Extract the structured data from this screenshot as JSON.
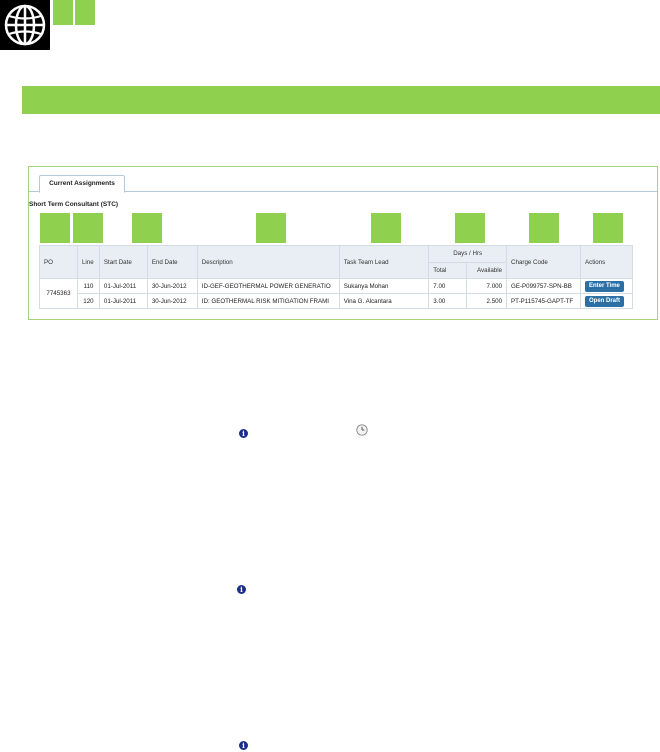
{
  "header": {
    "logo_icon": "world-bank-globe-icon",
    "accent_color": "#8fd14f"
  },
  "panel": {
    "tab_label": "Current Assignments",
    "section_title": "Short Term Consultant (STC)"
  },
  "table": {
    "columns": {
      "po": "PO",
      "line": "Line",
      "start_date": "Start Date",
      "end_date": "End Date",
      "description": "Description",
      "task_team_lead": "Task Team Lead",
      "days_hrs": "Days / Hrs",
      "total": "Total",
      "available": "Available",
      "charge_code": "Charge Code",
      "actions": "Actions"
    },
    "po_value": "7745363",
    "rows": [
      {
        "line": "110",
        "start_date": "01-Jul-2011",
        "end_date": "30-Jun-2012",
        "description": "ID-GEF-GEOTHERMAL POWER GENERATIO",
        "task_team_lead": "Sukanya Mohan",
        "total": "7.00",
        "available": "7.000",
        "charge_code": "GE-P099757-SPN-BB",
        "action": "Enter Time"
      },
      {
        "line": "120",
        "start_date": "01-Jul-2011",
        "end_date": "30-Jun-2012",
        "description": "ID: GEOTHERMAL RISK MITIGATION FRAMI",
        "task_team_lead": "Vina G. Alcantara",
        "total": "3.00",
        "available": "2.500",
        "charge_code": "PT-P115745-GAPT-TF",
        "action": "Open Draft"
      }
    ]
  },
  "icons": {
    "info": "info-icon",
    "info_glyph": "i",
    "clock": "clock-icon"
  }
}
